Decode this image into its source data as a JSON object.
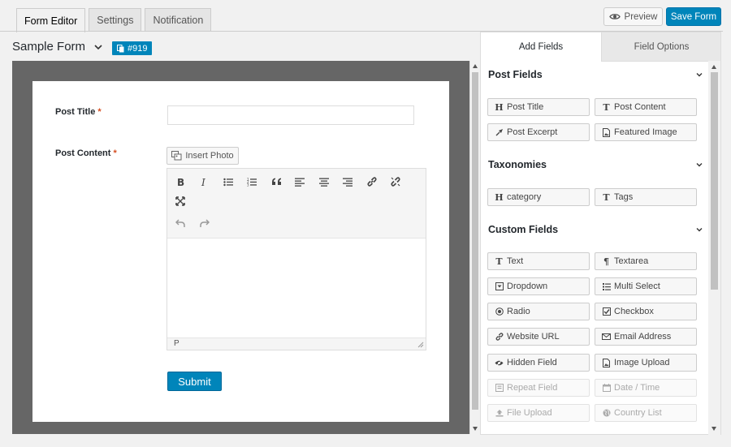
{
  "tabs": [
    {
      "label": "Form Editor"
    },
    {
      "label": "Settings"
    },
    {
      "label": "Notification"
    }
  ],
  "header": {
    "preview_label": "Preview",
    "save_label": "Save Form"
  },
  "form": {
    "name": "Sample Form",
    "id_badge": "#919"
  },
  "fields": {
    "post_title_label": "Post Title",
    "post_content_label": "Post Content",
    "required_mark": "*",
    "insert_photo_label": "Insert Photo",
    "status_path": "P",
    "submit_label": "Submit"
  },
  "panel": {
    "tabs": [
      {
        "label": "Add Fields"
      },
      {
        "label": "Field Options"
      }
    ],
    "sections": [
      {
        "title": "Post Fields",
        "items": [
          {
            "label": "Post Title",
            "icon": "heading-icon"
          },
          {
            "label": "Post Content",
            "icon": "text-icon"
          },
          {
            "label": "Post Excerpt",
            "icon": "pin-icon"
          },
          {
            "label": "Featured Image",
            "icon": "image-icon"
          }
        ]
      },
      {
        "title": "Taxonomies",
        "items": [
          {
            "label": "category",
            "icon": "heading-icon"
          },
          {
            "label": "Tags",
            "icon": "text-icon"
          }
        ]
      },
      {
        "title": "Custom Fields",
        "items": [
          {
            "label": "Text",
            "icon": "text-icon"
          },
          {
            "label": "Textarea",
            "icon": "paragraph-icon"
          },
          {
            "label": "Dropdown",
            "icon": "dropdown-icon"
          },
          {
            "label": "Multi Select",
            "icon": "list-icon"
          },
          {
            "label": "Radio",
            "icon": "radio-icon"
          },
          {
            "label": "Checkbox",
            "icon": "checkbox-icon"
          },
          {
            "label": "Website URL",
            "icon": "link-icon"
          },
          {
            "label": "Email Address",
            "icon": "envelope-icon"
          },
          {
            "label": "Hidden Field",
            "icon": "eye-slash-icon"
          },
          {
            "label": "Image Upload",
            "icon": "image-icon"
          },
          {
            "label": "Repeat Field",
            "icon": "repeat-icon"
          },
          {
            "label": "Date / Time",
            "icon": "calendar-icon"
          },
          {
            "label": "File Upload",
            "icon": "upload-icon"
          },
          {
            "label": "Country List",
            "icon": "globe-icon"
          }
        ]
      }
    ]
  },
  "colors": {
    "primary": "#0085ba",
    "required": "#d54e21"
  }
}
